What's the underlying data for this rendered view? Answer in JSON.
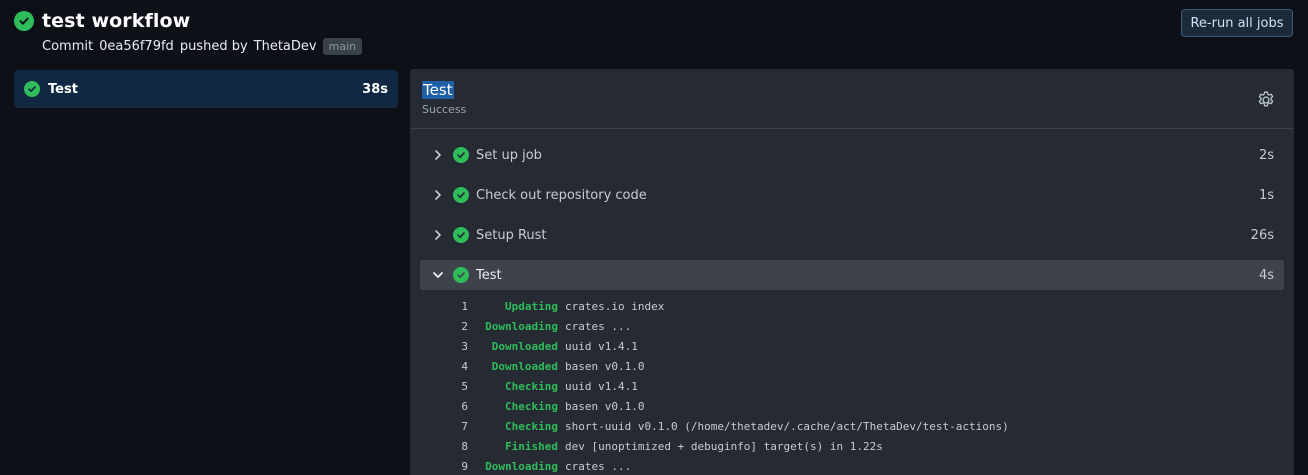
{
  "header": {
    "title": "test workflow",
    "commit_label": "Commit",
    "commit_hash": "0ea56f79fd",
    "pushed_by": "pushed by",
    "author": "ThetaDev",
    "branch": "main",
    "rerun_label": "Re-run all jobs"
  },
  "jobs": [
    {
      "name": "Test",
      "duration": "38s",
      "status": "success"
    }
  ],
  "panel": {
    "title": "Test",
    "subtitle": "Success",
    "settings_icon": "gear-icon",
    "steps": [
      {
        "name": "Set up job",
        "duration": "2s",
        "expanded": false
      },
      {
        "name": "Check out repository code",
        "duration": "1s",
        "expanded": false
      },
      {
        "name": "Setup Rust",
        "duration": "26s",
        "expanded": false
      },
      {
        "name": "Test",
        "duration": "4s",
        "expanded": true
      }
    ],
    "logs": [
      {
        "n": "1",
        "kw": "Updating",
        "msg": "crates.io index"
      },
      {
        "n": "2",
        "kw": "Downloading",
        "msg": "crates ..."
      },
      {
        "n": "3",
        "kw": "Downloaded",
        "msg": "uuid v1.4.1"
      },
      {
        "n": "4",
        "kw": "Downloaded",
        "msg": "basen v0.1.0"
      },
      {
        "n": "5",
        "kw": "Checking",
        "msg": "uuid v1.4.1"
      },
      {
        "n": "6",
        "kw": "Checking",
        "msg": "basen v0.1.0"
      },
      {
        "n": "7",
        "kw": "Checking",
        "msg": "short-uuid v0.1.0 (/home/thetadev/.cache/act/ThetaDev/test-actions)"
      },
      {
        "n": "8",
        "kw": "Finished",
        "msg": "dev [unoptimized + debuginfo] target(s) in 1.22s"
      },
      {
        "n": "9",
        "kw": "Downloading",
        "msg": "crates ..."
      }
    ]
  },
  "colors": {
    "success": "#2fbd5b",
    "background": "#0d1117",
    "panel": "#262a33",
    "selected_job": "#102841"
  }
}
